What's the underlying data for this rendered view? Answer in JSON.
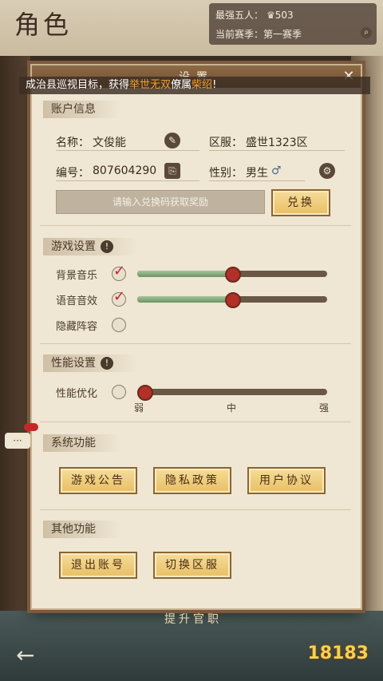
{
  "background": {
    "title": "角色",
    "top_stats": [
      {
        "label": "最强五人：",
        "value": "503"
      },
      {
        "label": "当前赛季：",
        "value": "第一赛季"
      }
    ],
    "upgrade_label": "提升官职",
    "watermark": "18183"
  },
  "dialog": {
    "title": "设置",
    "notice": {
      "prefix": "成治县巡视目标，获得",
      "hl1": "举世无双",
      "mid": "僚属",
      "hl2": "柴绍",
      "suffix": "!"
    },
    "account": {
      "section": "账户信息",
      "name_label": "名称：",
      "name_value": "文俊能",
      "server_label": "区服：",
      "server_value": "盛世1323区",
      "id_label": "编号：",
      "id_value": "807604290",
      "gender_label": "性别：",
      "gender_value": "男生",
      "redeem_placeholder": "请输入兑换码获取奖励",
      "redeem_button": "兑换"
    },
    "game_settings": {
      "section": "游戏设置",
      "bgm_label": "背景音乐",
      "bgm_checked": true,
      "bgm_level": 0.5,
      "voice_label": "语音音效",
      "voice_checked": true,
      "voice_level": 0.5,
      "hide_label": "隐藏阵容",
      "hide_checked": false
    },
    "performance": {
      "section": "性能设置",
      "opt_label": "性能优化",
      "opt_checked": false,
      "level": 0,
      "ticks": [
        "弱",
        "中",
        "强"
      ]
    },
    "system": {
      "section": "系统功能",
      "buttons": [
        "游戏公告",
        "隐私政策",
        "用户协议"
      ]
    },
    "other": {
      "section": "其他功能",
      "buttons": [
        "退出账号",
        "切换区服"
      ]
    }
  },
  "colors": {
    "accent": "#b33028",
    "highlight": "#f0a030",
    "button_bg": "#f6dc9a"
  }
}
